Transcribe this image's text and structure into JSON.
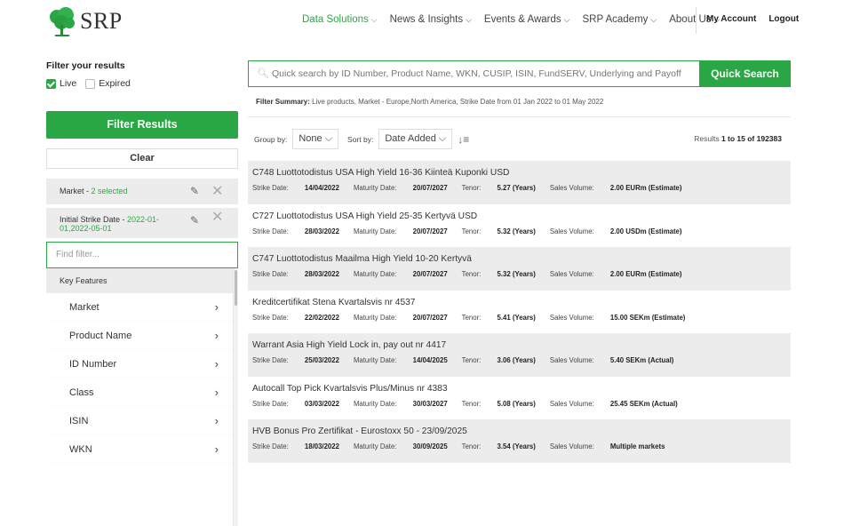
{
  "brand": {
    "name": "SRP",
    "accent": "#2aa745"
  },
  "nav": {
    "items": [
      {
        "label": "Data Solutions",
        "active": true
      },
      {
        "label": "News & Insights",
        "active": false
      },
      {
        "label": "Events & Awards",
        "active": false
      },
      {
        "label": "SRP Academy",
        "active": false
      },
      {
        "label": "About Us",
        "active": false
      }
    ],
    "my_account": "My Account",
    "logout": "Logout"
  },
  "sidebar": {
    "filter_title": "Filter your results",
    "live_label": "Live",
    "expired_label": "Expired",
    "filter_button": "Filter Results",
    "clear_button": "Clear",
    "chips": [
      {
        "label": "Market - ",
        "value": "2 selected"
      },
      {
        "label": "Initial Strike Date - ",
        "value": "2022-01-01,2022-05-01"
      }
    ],
    "find_placeholder": "Find filter...",
    "key_features": "Key Features",
    "filters": [
      "Market",
      "Product Name",
      "ID Number",
      "Class",
      "ISIN",
      "WKN"
    ]
  },
  "search": {
    "placeholder": "Quick search by ID Number, Product Name, WKN, CUSIP, ISIN, FundSERV, Underlying and Payoff",
    "button": "Quick Search"
  },
  "summary": {
    "label": "Filter Summary:",
    "text": "Live products, Market - Europe,North America, Strike Date from 01 Jan 2022 to 01 May 2022"
  },
  "controls": {
    "group_by_label": "Group by:",
    "group_by_value": "None",
    "sort_by_label": "Sort by:",
    "sort_by_value": "Date Added",
    "results_prefix": "Results ",
    "results_range": "1 to 15 of 192383"
  },
  "row_labels": {
    "strike": "Strike Date: ",
    "maturity": "Maturity Date: ",
    "tenor": "Tenor: ",
    "sales": "Sales Volume: "
  },
  "products": [
    {
      "name": "C748 Luottotodistus USA High Yield 16-36 Kiinteä Kuponki USD",
      "strike": "14/04/2022",
      "maturity": "20/07/2027",
      "tenor": "5.27 (Years)",
      "sales": "2.00 EURm (Estimate)"
    },
    {
      "name": "C727 Luottotodistus USA High Yield 25-35 Kertyvä USD",
      "strike": "28/03/2022",
      "maturity": "20/07/2027",
      "tenor": "5.32 (Years)",
      "sales": "2.00 USDm (Estimate)"
    },
    {
      "name": "C747 Luottotodistus Maailma High Yield 10-20 Kertyvä",
      "strike": "28/03/2022",
      "maturity": "20/07/2027",
      "tenor": "5.32 (Years)",
      "sales": "2.00 EURm (Estimate)"
    },
    {
      "name": "Kreditcertifikat Stena Kvartalsvis nr 4537",
      "strike": "22/02/2022",
      "maturity": "20/07/2027",
      "tenor": "5.41 (Years)",
      "sales": "15.00 SEKm (Estimate)"
    },
    {
      "name": "Warrant Asia High Yield Lock in, pay out nr 4417",
      "strike": "25/03/2022",
      "maturity": "14/04/2025",
      "tenor": "3.06 (Years)",
      "sales": "5.40 SEKm (Actual)"
    },
    {
      "name": "Autocall Top Pick Kvartalsvis Plus/Minus nr 4383",
      "strike": "03/03/2022",
      "maturity": "30/03/2027",
      "tenor": "5.08 (Years)",
      "sales": "25.45 SEKm (Actual)"
    },
    {
      "name": "HVB Bonus Pro Zertifikat - Eurostoxx 50 - 23/09/2025",
      "strike": "18/03/2022",
      "maturity": "30/09/2025",
      "tenor": "3.54 (Years)",
      "sales": "Multiple markets"
    }
  ]
}
